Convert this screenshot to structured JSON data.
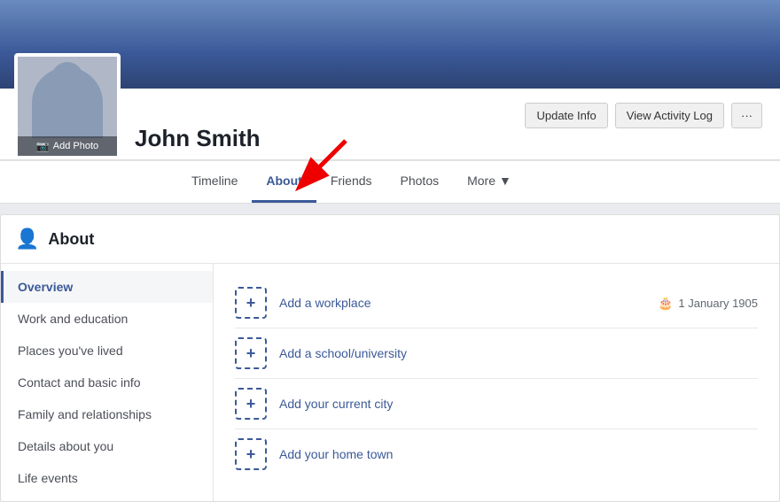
{
  "profile": {
    "name": "John Smith",
    "add_photo_label": "Add Photo",
    "avatar_alt": "Profile photo"
  },
  "actions": {
    "update_info": "Update Info",
    "view_activity_log": "View Activity Log",
    "more_dots": "···"
  },
  "nav": {
    "tabs": [
      {
        "label": "Timeline",
        "active": false
      },
      {
        "label": "About",
        "active": true
      },
      {
        "label": "Friends",
        "active": false
      },
      {
        "label": "Photos",
        "active": false
      },
      {
        "label": "More",
        "active": false,
        "has_dropdown": true
      }
    ]
  },
  "about": {
    "title": "About",
    "sidebar": [
      {
        "label": "Overview",
        "active": true
      },
      {
        "label": "Work and education",
        "active": false
      },
      {
        "label": "Places you've lived",
        "active": false
      },
      {
        "label": "Contact and basic info",
        "active": false
      },
      {
        "label": "Family and relationships",
        "active": false
      },
      {
        "label": "Details about you",
        "active": false
      },
      {
        "label": "Life events",
        "active": false
      }
    ],
    "content_items": [
      {
        "label": "Add a workplace",
        "birthday": "1 January 1905"
      },
      {
        "label": "Add a school/university",
        "birthday": ""
      },
      {
        "label": "Add your current city",
        "birthday": ""
      },
      {
        "label": "Add your home town",
        "birthday": ""
      }
    ]
  }
}
